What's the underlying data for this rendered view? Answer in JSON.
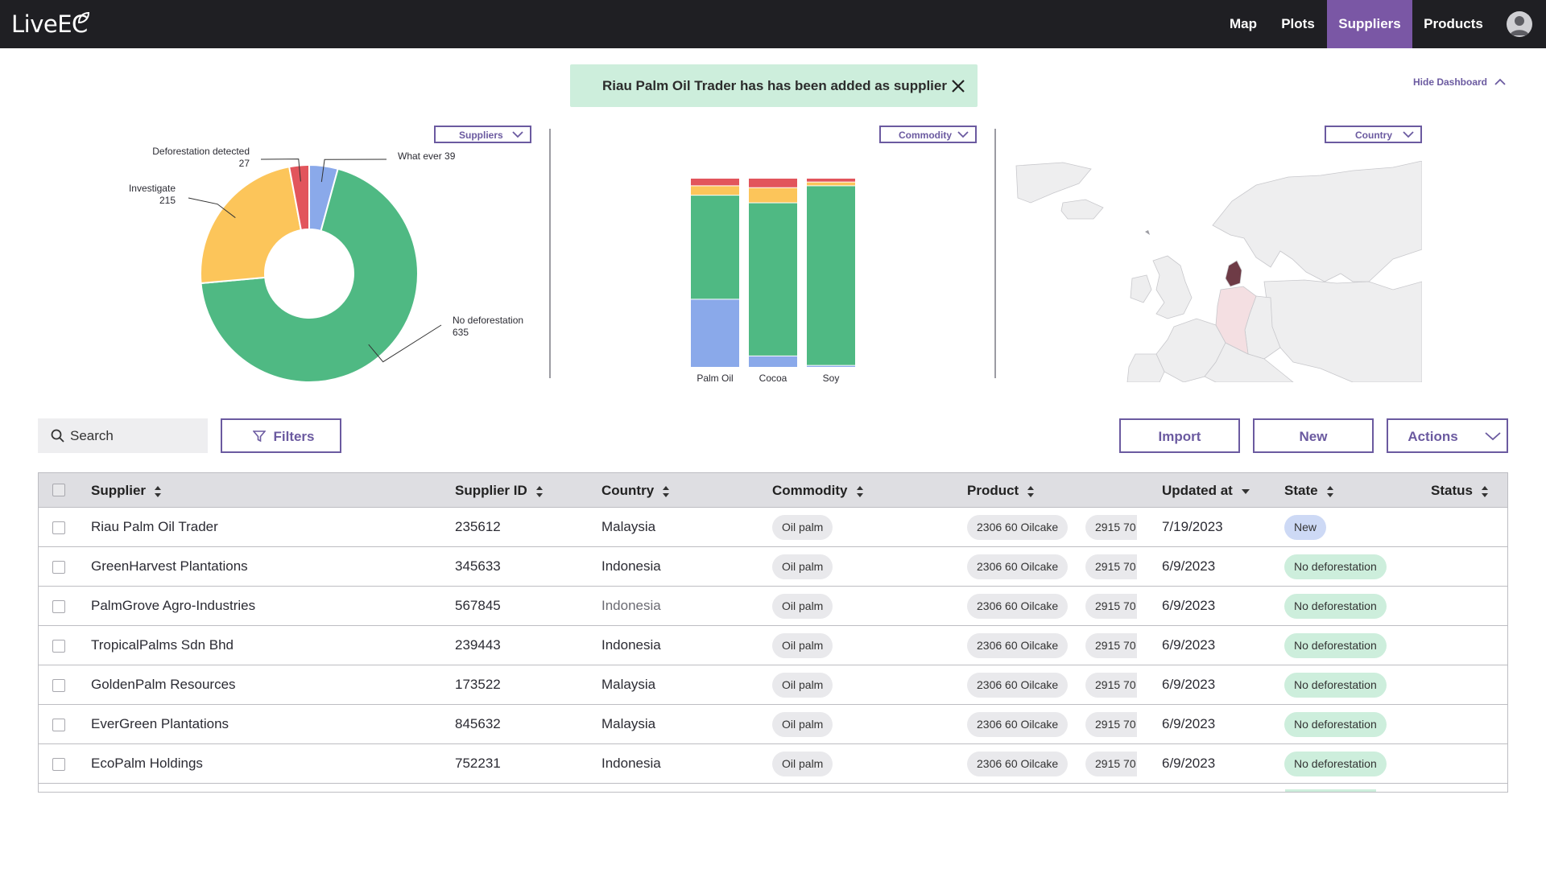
{
  "app": {
    "logo_text": "LiveEU"
  },
  "nav": {
    "items": [
      {
        "label": "Map",
        "active": false
      },
      {
        "label": "Plots",
        "active": false
      },
      {
        "label": "Suppliers",
        "active": true
      },
      {
        "label": "Products",
        "active": false
      }
    ],
    "accent": "#7a57a5"
  },
  "toast": {
    "message": "Riau Palm Oil Trader has has been added as supplier"
  },
  "dashboard": {
    "hide_label": "Hide Dashboard",
    "dropdowns": {
      "suppliers": "Suppliers",
      "commodity": "Commodity",
      "country": "Country"
    }
  },
  "chart_data": [
    {
      "type": "pie",
      "style": "donut",
      "slices": [
        {
          "label": "What ever",
          "value": 39,
          "color": "#8aa9ea"
        },
        {
          "label": "No deforestation",
          "value": 635,
          "color": "#4fb983"
        },
        {
          "label": "Investigate",
          "value": 215,
          "color": "#fcc55a"
        },
        {
          "label": "Deforestation detected",
          "value": 27,
          "color": "#e2555c"
        }
      ]
    },
    {
      "type": "bar",
      "stacked": true,
      "normalized": true,
      "categories": [
        "Palm Oil",
        "Cocoa",
        "Soy"
      ],
      "series": [
        {
          "color": "#8aa9ea",
          "values": [
            0.36,
            0.06,
            0.01
          ]
        },
        {
          "color": "#4fb983",
          "values": [
            0.55,
            0.81,
            0.95
          ]
        },
        {
          "color": "#fcc55a",
          "values": [
            0.05,
            0.08,
            0.02
          ]
        },
        {
          "color": "#e2555c",
          "values": [
            0.04,
            0.05,
            0.02
          ]
        }
      ]
    }
  ],
  "map": {
    "highlight_colors": {
      "selected": "#6e3b46",
      "hover": "#f4dfe2"
    }
  },
  "toolbar": {
    "search_placeholder": "Search",
    "filters_label": "Filters",
    "import_label": "Import",
    "new_label": "New",
    "actions_label": "Actions"
  },
  "table": {
    "columns": [
      "Supplier",
      "Supplier ID",
      "Country",
      "Commodity",
      "Product",
      "Updated at",
      "State",
      "Status"
    ],
    "rows": [
      {
        "supplier": "Riau Palm Oil Trader",
        "id": "235612",
        "country": "Malaysia",
        "commodity": "Oil palm",
        "product1": "2306  60 Oilcake",
        "product2": "2915 70",
        "updated": "7/19/2023",
        "state": "New",
        "state_color": "blue",
        "status": ""
      },
      {
        "supplier": "GreenHarvest Plantations",
        "id": "345633",
        "country": "Indonesia",
        "commodity": "Oil palm",
        "product1": "2306  60 Oilcake",
        "product2": "2915 70",
        "updated": "6/9/2023",
        "state": "No deforestation",
        "state_color": "green",
        "status": ""
      },
      {
        "supplier": "PalmGrove Agro-Industries",
        "id": "567845",
        "country": "Indonesia",
        "commodity": "Oil palm",
        "product1": "2306  60 Oilcake",
        "product2": "2915 70",
        "updated": "6/9/2023",
        "state": "No deforestation",
        "state_color": "green",
        "status": ""
      },
      {
        "supplier": "TropicalPalms Sdn Bhd",
        "id": "239443",
        "country": "Indonesia",
        "commodity": "Oil palm",
        "product1": "2306  60 Oilcake",
        "product2": "2915 70",
        "updated": "6/9/2023",
        "state": "No deforestation",
        "state_color": "green",
        "status": ""
      },
      {
        "supplier": "GoldenPalm Resources",
        "id": "173522",
        "country": "Malaysia",
        "commodity": "Oil palm",
        "product1": "2306  60 Oilcake",
        "product2": "2915 70",
        "updated": "6/9/2023",
        "state": "No deforestation",
        "state_color": "green",
        "status": ""
      },
      {
        "supplier": "EverGreen Plantations",
        "id": "845632",
        "country": "Malaysia",
        "commodity": "Oil palm",
        "product1": "2306  60 Oilcake",
        "product2": "2915 70",
        "updated": "6/9/2023",
        "state": "No deforestation",
        "state_color": "green",
        "status": ""
      },
      {
        "supplier": "EcoPalm Holdings",
        "id": "752231",
        "country": "Indonesia",
        "commodity": "Oil palm",
        "product1": "2306  60 Oilcake",
        "product2": "2915 70",
        "updated": "6/9/2023",
        "state": "No deforestation",
        "state_color": "green",
        "status": ""
      }
    ]
  }
}
